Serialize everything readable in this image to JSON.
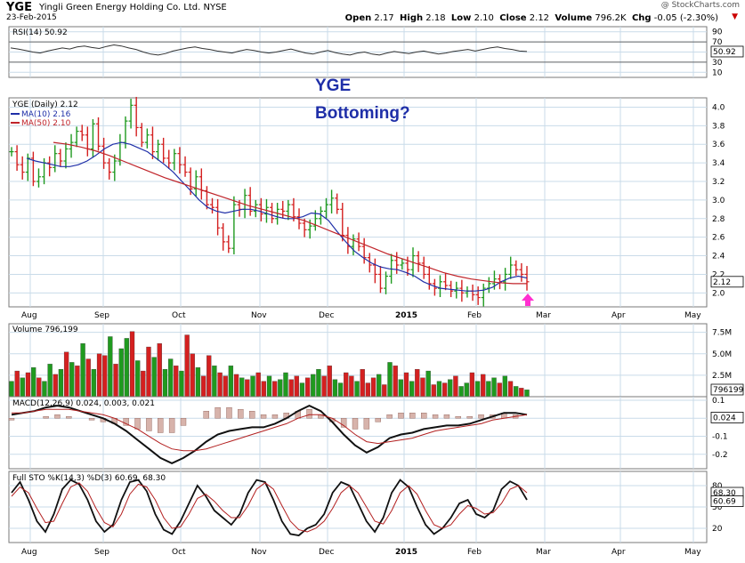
{
  "header": {
    "symbol": "YGE",
    "company": "Yingli Green Energy Holding Co. Ltd.  NYSE",
    "date": "23-Feb-2015",
    "watermark": "@ StockCharts.com",
    "open_label": "Open",
    "open": "2.17",
    "high_label": "High",
    "high": "2.18",
    "low_label": "Low",
    "low": "2.10",
    "close_label": "Close",
    "close": "2.12",
    "volume_label": "Volume",
    "volume": "796.2K",
    "chg_label": "Chg",
    "chg": "-0.05 (-2.30%)",
    "chg_arrow": "▼"
  },
  "annotation": {
    "line1": "YGE",
    "line2": "Bottoming?",
    "color": "#1f2fa8"
  },
  "colors": {
    "up": "#1f9a1f",
    "down": "#d42020",
    "ma10": "#1f2fa8",
    "ma50": "#c0242a",
    "arrow": "#ff2fd0",
    "grid": "#c9dbe9"
  },
  "chart_data": [
    {
      "id": "rsi",
      "type": "line",
      "legend": "RSI(14) 50.92",
      "y_ticks": [
        "90",
        "70",
        "50",
        "30",
        "10"
      ],
      "current_label": "50.92",
      "ylim": [
        0,
        100
      ],
      "values": [
        58,
        56,
        53,
        50,
        48,
        52,
        55,
        58,
        56,
        60,
        62,
        59,
        57,
        61,
        64,
        62,
        58,
        55,
        50,
        46,
        44,
        47,
        52,
        55,
        58,
        60,
        57,
        55,
        52,
        50,
        48,
        52,
        55,
        53,
        50,
        48,
        50,
        53,
        56,
        52,
        48,
        46,
        50,
        53,
        49,
        46,
        44,
        48,
        50,
        46,
        44,
        48,
        51,
        49,
        47,
        50,
        52,
        49,
        46,
        48,
        51,
        53,
        55,
        52,
        55,
        58,
        60,
        57,
        55,
        52,
        51
      ]
    },
    {
      "id": "price",
      "type": "ohlc",
      "legend_main": "YGE (Daily) 2.12",
      "legend_ma10": "MA(10) 2.16",
      "legend_ma50": "MA(50) 2.10",
      "current_label": "2.12",
      "y_ticks": [
        "4.0",
        "3.8",
        "3.6",
        "3.4",
        "3.2",
        "3.0",
        "2.8",
        "2.6",
        "2.4",
        "2.2",
        "2.0"
      ],
      "ylim": [
        1.85,
        4.1
      ],
      "x_labels": [
        "Aug",
        "Sep",
        "Oct",
        "Nov",
        "Dec",
        "2015",
        "Feb",
        "Mar",
        "Apr",
        "May"
      ],
      "closes": [
        3.52,
        3.38,
        3.3,
        3.45,
        3.2,
        3.25,
        3.4,
        3.35,
        3.5,
        3.42,
        3.55,
        3.62,
        3.74,
        3.7,
        3.55,
        3.82,
        3.58,
        3.4,
        3.3,
        3.42,
        3.62,
        3.85,
        4.02,
        3.78,
        3.62,
        3.7,
        3.52,
        3.6,
        3.45,
        3.4,
        3.5,
        3.38,
        3.3,
        3.12,
        3.25,
        3.1,
        2.95,
        2.92,
        2.7,
        2.55,
        2.48,
        2.95,
        2.9,
        3.05,
        2.88,
        2.95,
        2.85,
        2.92,
        2.8,
        2.9,
        2.88,
        2.95,
        2.82,
        2.75,
        2.68,
        2.72,
        2.8,
        2.88,
        2.95,
        3.02,
        2.9,
        2.62,
        2.5,
        2.58,
        2.5,
        2.38,
        2.3,
        2.2,
        2.05,
        2.18,
        2.35,
        2.3,
        2.32,
        2.25,
        2.4,
        2.32,
        2.2,
        2.1,
        2.05,
        2.12,
        2.08,
        2.02,
        2.05,
        2.0,
        2.02,
        1.98,
        1.95,
        2.05,
        2.1,
        2.15,
        2.12,
        2.2,
        2.3,
        2.25,
        2.2,
        2.12
      ],
      "ma10": [
        3.45,
        3.42,
        3.4,
        3.38,
        3.36,
        3.36,
        3.38,
        3.42,
        3.48,
        3.55,
        3.6,
        3.62,
        3.6,
        3.56,
        3.52,
        3.45,
        3.38,
        3.3,
        3.2,
        3.1,
        3.0,
        2.92,
        2.88,
        2.86,
        2.88,
        2.9,
        2.9,
        2.88,
        2.85,
        2.82,
        2.8,
        2.8,
        2.82,
        2.86,
        2.85,
        2.78,
        2.66,
        2.55,
        2.45,
        2.38,
        2.32,
        2.28,
        2.26,
        2.25,
        2.22,
        2.18,
        2.12,
        2.08,
        2.05,
        2.04,
        2.03,
        2.02,
        2.02,
        2.03,
        2.06,
        2.12,
        2.16,
        2.18,
        2.16
      ],
      "ma50": [
        3.62,
        3.6,
        3.57,
        3.53,
        3.48,
        3.42,
        3.36,
        3.3,
        3.24,
        3.19,
        3.14,
        3.09,
        3.04,
        2.99,
        2.94,
        2.9,
        2.86,
        2.82,
        2.78,
        2.72,
        2.66,
        2.6,
        2.54,
        2.48,
        2.42,
        2.37,
        2.32,
        2.27,
        2.22,
        2.18,
        2.15,
        2.13,
        2.11,
        2.1,
        2.1
      ]
    },
    {
      "id": "volume",
      "type": "bar",
      "legend": "Volume 796,199",
      "current_label": "796199",
      "y_ticks": [
        "7.5M",
        "5.0M",
        "2.5M"
      ],
      "ylim": [
        0,
        8.5
      ],
      "values": [
        1.8,
        3.0,
        2.2,
        2.8,
        3.4,
        2.2,
        1.8,
        3.8,
        2.6,
        3.2,
        5.2,
        4.0,
        3.6,
        6.2,
        4.4,
        3.2,
        5.0,
        4.8,
        7.0,
        3.8,
        5.6,
        6.8,
        7.6,
        4.2,
        3.0,
        5.8,
        4.6,
        6.2,
        3.2,
        4.4,
        3.6,
        3.0,
        7.2,
        5.0,
        3.4,
        2.4,
        4.8,
        3.6,
        2.8,
        2.4,
        3.6,
        2.6,
        2.2,
        2.0,
        2.4,
        2.8,
        1.8,
        2.4,
        1.8,
        2.0,
        2.8,
        2.0,
        2.4,
        1.6,
        2.2,
        2.6,
        3.2,
        2.4,
        3.6,
        2.0,
        1.6,
        2.8,
        2.4,
        1.8,
        3.2,
        1.6,
        2.2,
        2.6,
        1.4,
        4.0,
        3.6,
        2.0,
        2.8,
        1.8,
        3.2,
        2.2,
        3.0,
        1.4,
        1.8,
        1.6,
        2.0,
        2.4,
        1.2,
        1.6,
        2.8,
        1.8,
        2.6,
        1.8,
        2.2,
        1.6,
        2.4,
        1.8,
        1.2,
        1.0,
        0.8
      ],
      "up": [
        1,
        0,
        1,
        0,
        1,
        0,
        1,
        1,
        0,
        1,
        0,
        1,
        0,
        1,
        0,
        1,
        0,
        0,
        1,
        0,
        1,
        1,
        0,
        1,
        0,
        0,
        1,
        0,
        1,
        1,
        0,
        1,
        0,
        0,
        1,
        0,
        0,
        1,
        0,
        0,
        1,
        0,
        1,
        0,
        1,
        0,
        0,
        1,
        0,
        1,
        1,
        0,
        0,
        1,
        0,
        1,
        1,
        0,
        0,
        1,
        1,
        0,
        0,
        1,
        0,
        0,
        0,
        1,
        0,
        1,
        0,
        1,
        0,
        1,
        0,
        0,
        1,
        0,
        1,
        0,
        1,
        0,
        1,
        1,
        0,
        1,
        0,
        1,
        1,
        0,
        1,
        0,
        1,
        0,
        1
      ]
    },
    {
      "id": "macd",
      "type": "line",
      "legend": "MACD(12,26,9) 0.024, 0.003, 0.021",
      "current_label": "0.024",
      "y_ticks": [
        "0.1",
        "0.0",
        "-0.1",
        "-0.2"
      ],
      "ylim": [
        -0.28,
        0.12
      ],
      "macd": [
        0.02,
        0.03,
        0.04,
        0.06,
        0.07,
        0.06,
        0.04,
        0.02,
        0.0,
        -0.03,
        -0.07,
        -0.12,
        -0.17,
        -0.22,
        -0.25,
        -0.22,
        -0.18,
        -0.13,
        -0.09,
        -0.07,
        -0.06,
        -0.05,
        -0.05,
        -0.03,
        0.0,
        0.04,
        0.07,
        0.04,
        -0.02,
        -0.09,
        -0.15,
        -0.19,
        -0.16,
        -0.11,
        -0.09,
        -0.08,
        -0.06,
        -0.05,
        -0.04,
        -0.04,
        -0.03,
        -0.01,
        0.01,
        0.03,
        0.03,
        0.02
      ],
      "signal": [
        0.03,
        0.03,
        0.04,
        0.05,
        0.05,
        0.05,
        0.04,
        0.03,
        0.02,
        0.0,
        -0.03,
        -0.06,
        -0.1,
        -0.14,
        -0.17,
        -0.18,
        -0.18,
        -0.17,
        -0.15,
        -0.13,
        -0.11,
        -0.09,
        -0.07,
        -0.05,
        -0.03,
        0.0,
        0.02,
        0.02,
        0.0,
        -0.04,
        -0.09,
        -0.13,
        -0.14,
        -0.13,
        -0.12,
        -0.11,
        -0.09,
        -0.07,
        -0.06,
        -0.05,
        -0.04,
        -0.03,
        -0.01,
        0.0,
        0.01,
        0.02
      ]
    },
    {
      "id": "sto",
      "type": "line",
      "legend": "Full STO %K(14,3) %D(3) 60.69, 68.30",
      "current_labels": [
        "68.30",
        "60.69"
      ],
      "y_ticks": [
        "80",
        "50",
        "20"
      ],
      "ylim": [
        0,
        100
      ],
      "k": [
        70,
        85,
        60,
        30,
        15,
        40,
        75,
        88,
        82,
        60,
        30,
        15,
        25,
        60,
        85,
        88,
        72,
        40,
        18,
        12,
        30,
        55,
        80,
        65,
        45,
        35,
        25,
        40,
        70,
        88,
        85,
        60,
        30,
        12,
        10,
        20,
        25,
        40,
        70,
        85,
        80,
        55,
        30,
        15,
        35,
        70,
        88,
        78,
        50,
        25,
        12,
        20,
        35,
        55,
        60,
        40,
        35,
        45,
        75,
        86,
        80,
        60
      ],
      "d": [
        65,
        78,
        70,
        48,
        28,
        30,
        55,
        78,
        84,
        72,
        48,
        28,
        22,
        40,
        68,
        82,
        78,
        60,
        35,
        20,
        22,
        40,
        62,
        68,
        58,
        45,
        35,
        35,
        52,
        75,
        84,
        75,
        52,
        30,
        18,
        15,
        20,
        30,
        48,
        70,
        80,
        70,
        50,
        30,
        26,
        45,
        70,
        80,
        68,
        45,
        25,
        20,
        25,
        40,
        52,
        48,
        40,
        42,
        55,
        75,
        80,
        70
      ]
    }
  ]
}
